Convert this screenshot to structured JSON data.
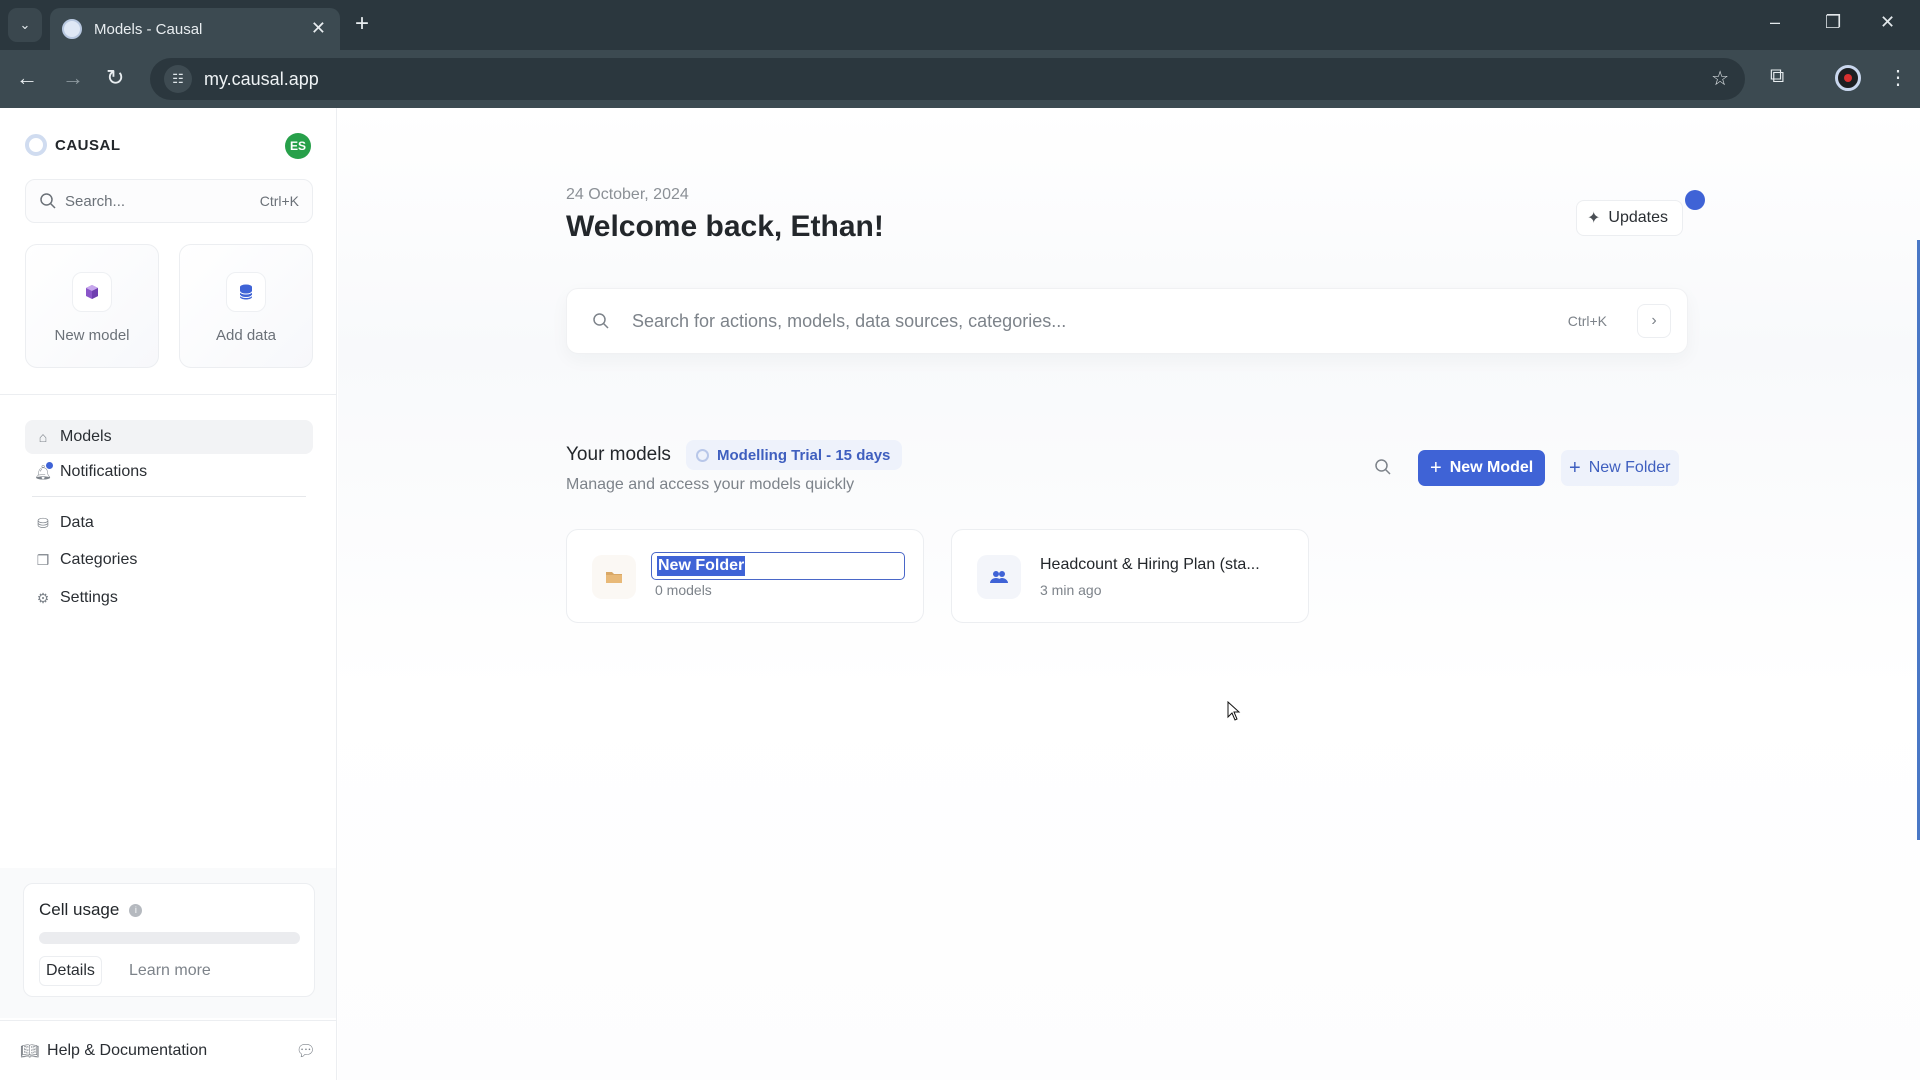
{
  "browser": {
    "tab_title": "Models - Causal",
    "url": "my.causal.app",
    "icons": {
      "tab_dropdown": "chevron-down-icon",
      "tab_close": "close-icon",
      "new_tab": "plus-icon",
      "back": "arrow-left-icon",
      "forward": "arrow-right-icon",
      "reload": "reload-icon",
      "site_info": "tune-icon",
      "bookmark": "star-icon",
      "extensions": "puzzle-icon",
      "menu": "kebab-menu-icon"
    },
    "window_controls": {
      "minimize": "–",
      "restore": "❐",
      "close": "✕"
    }
  },
  "sidebar": {
    "brand": "CAUSAL",
    "avatar_initials": "ES",
    "search": {
      "placeholder": "Search...",
      "shortcut": "Ctrl+K"
    },
    "quick_actions": [
      {
        "label": "New model",
        "icon": "cube-icon"
      },
      {
        "label": "Add data",
        "icon": "database-icon"
      }
    ],
    "nav": [
      {
        "label": "Models",
        "icon": "home-icon",
        "active": true
      },
      {
        "label": "Notifications",
        "icon": "bell-icon",
        "has_badge": true
      },
      {
        "label": "Data",
        "icon": "database-icon"
      },
      {
        "label": "Categories",
        "icon": "copy-icon"
      },
      {
        "label": "Settings",
        "icon": "gear-icon"
      }
    ],
    "cell_usage": {
      "title": "Cell usage",
      "progress": 0,
      "details_label": "Details",
      "learn_more_label": "Learn more"
    },
    "help": {
      "label": "Help & Documentation"
    }
  },
  "main": {
    "date": "24 October, 2024",
    "welcome": "Welcome back, Ethan!",
    "updates_label": "Updates",
    "search": {
      "placeholder": "Search for actions, models, data sources, categories...",
      "shortcut": "Ctrl+K"
    },
    "your_models": {
      "title": "Your models",
      "trial_badge": "Modelling Trial - 15 days",
      "subtitle": "Manage and access your models quickly",
      "new_model_label": "New Model",
      "new_folder_label": "New Folder"
    },
    "cards": [
      {
        "type": "folder",
        "title_input_value": "New Folder",
        "subtitle": "0 models",
        "icon": "folder-icon"
      },
      {
        "type": "model",
        "title": "Headcount & Hiring Plan (sta...",
        "subtitle": "3 min ago",
        "icon": "users-icon"
      }
    ]
  },
  "colors": {
    "accent": "#3f63d6",
    "accent_soft": "#eef2fb",
    "avatar": "#27a04a",
    "chrome_dark": "#2b373e",
    "chrome_toolbar": "#3c4a51"
  }
}
